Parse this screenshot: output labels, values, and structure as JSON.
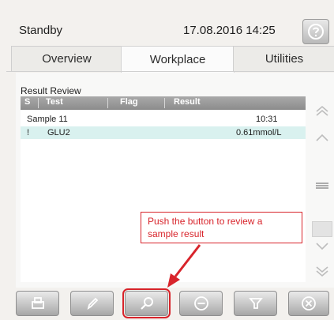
{
  "header": {
    "status": "Standby",
    "datetime": "17.08.2016 14:25",
    "help_icon": "help-icon"
  },
  "tabs": [
    {
      "label": "Overview",
      "active": false
    },
    {
      "label": "Workplace",
      "active": true
    },
    {
      "label": "Utilities",
      "active": false
    }
  ],
  "result_review": {
    "title": "Result Review",
    "columns": [
      "S",
      "Test",
      "Flag",
      "Result"
    ],
    "rows": [
      {
        "s": "",
        "test": "Sample 11",
        "flag": "",
        "result": "10:31",
        "selected": false
      },
      {
        "s": "!",
        "test": "GLU2",
        "flag": "",
        "result": "0.61mmol/L",
        "selected": true
      }
    ]
  },
  "scroll": {
    "icons": [
      "double-chevron-up-icon",
      "chevron-up-icon",
      "list-icon",
      "chevron-down-icon",
      "double-chevron-down-icon"
    ]
  },
  "callout": {
    "text": "Push the button to review a sample result",
    "color": "#d8242b"
  },
  "toolbar": {
    "icons": [
      "print-icon",
      "pencil-icon",
      "magnifier-icon",
      "minus-circle-icon",
      "filter-icon",
      "close-circle-icon"
    ],
    "highlighted": "magnifier-icon"
  }
}
